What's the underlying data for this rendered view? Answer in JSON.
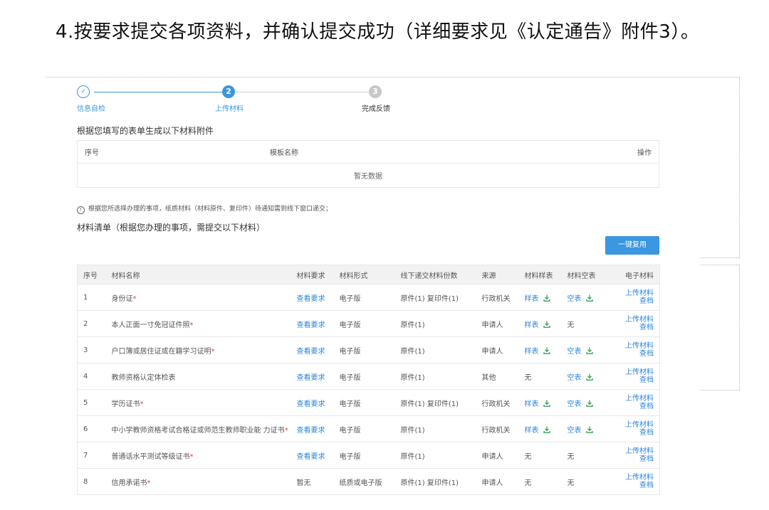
{
  "heading": "4.按要求提交各项资料，并确认提交成功（详细要求见《认定通告》附件3）。",
  "stepper": {
    "steps": [
      {
        "num": "✓",
        "label": "信息自检",
        "state": "done"
      },
      {
        "num": "2",
        "label": "上传材料",
        "state": "active"
      },
      {
        "num": "3",
        "label": "完成反馈",
        "state": "pending"
      }
    ]
  },
  "template_section": {
    "title": "根据您填写的表单生成以下材料附件",
    "headers": [
      "序号",
      "模板名称",
      "操作"
    ],
    "empty_text": "暂无数据"
  },
  "notice": "根据您所选择办理的事项，纸质材料（材料原件、复印件）待通知需到线下窗口递交；",
  "materials_section": {
    "title": "材料清单（根据您办理的事项，需提交以下材料）",
    "copy_button": "一键复用",
    "headers": [
      "序号",
      "材料名称",
      "材料要求",
      "材料形式",
      "线下递交材料份数",
      "来源",
      "材料样表",
      "材料空表",
      "电子材料"
    ],
    "upload_label": "上传材料",
    "view_label": "查档",
    "rows": [
      {
        "no": "1",
        "name": "身份证",
        "required": true,
        "req": "查看要求",
        "form": "电子版",
        "copies": "原件(1) 复印件(1)",
        "source": "行政机关",
        "sample": "样表",
        "blank": "空表"
      },
      {
        "no": "2",
        "name": "本人正面一寸免冠证件照",
        "required": true,
        "req": "查看要求",
        "form": "电子版",
        "copies": "原件(1)",
        "source": "申请人",
        "sample": "样表",
        "blank": "无"
      },
      {
        "no": "3",
        "name": "户口簿或居住证或在籍学习证明",
        "required": true,
        "req": "查看要求",
        "form": "电子版",
        "copies": "原件(1)",
        "source": "申请人",
        "sample": "样表",
        "blank": "空表"
      },
      {
        "no": "4",
        "name": "教师资格认定体检表",
        "required": false,
        "req": "查看要求",
        "form": "电子版",
        "copies": "原件(1)",
        "source": "其他",
        "sample": "无",
        "blank": "空表"
      },
      {
        "no": "5",
        "name": "学历证书",
        "required": true,
        "req": "查看要求",
        "form": "电子版",
        "copies": "原件(1) 复印件(1)",
        "source": "行政机关",
        "sample": "样表",
        "blank": "空表"
      },
      {
        "no": "6",
        "name": "中小学教师资格考试合格证或师范生教师职业能 力证书",
        "required": true,
        "req": "查看要求",
        "form": "电子版",
        "copies": "原件(1)",
        "source": "行政机关",
        "sample": "样表",
        "blank": "空表"
      },
      {
        "no": "7",
        "name": "普通话水平测试等级证书",
        "required": true,
        "req": "查看要求",
        "form": "电子版",
        "copies": "原件(1)",
        "source": "申请人",
        "sample": "无",
        "blank": "无"
      },
      {
        "no": "8",
        "name": "信用承诺书",
        "required": true,
        "req": "暂无",
        "form": "纸质或电子版",
        "copies": "原件(1) 复印件(1)",
        "source": "申请人",
        "sample": "无",
        "blank": "无"
      }
    ]
  },
  "colors": {
    "accent": "#3a97e0",
    "pending": "#c8c8c8",
    "link": "#2e86de",
    "required": "#e04040"
  }
}
